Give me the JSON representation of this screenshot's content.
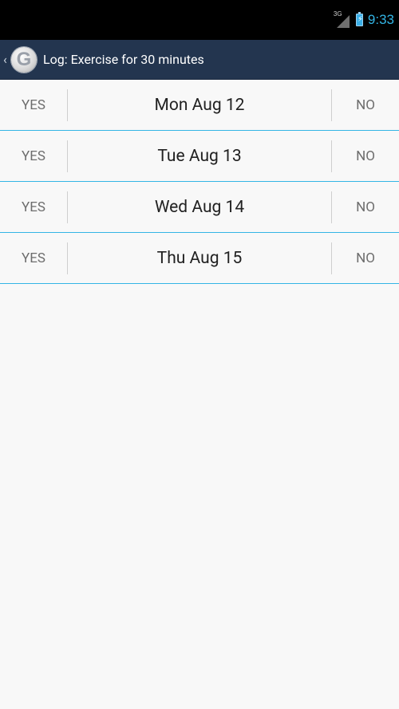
{
  "status_bar": {
    "network": "3G",
    "time": "9:33"
  },
  "action_bar": {
    "title": "Log: Exercise for 30 minutes",
    "logo_letter": "G"
  },
  "rows": [
    {
      "yes": "YES",
      "date": "Mon Aug 12",
      "no": "NO"
    },
    {
      "yes": "YES",
      "date": "Tue Aug 13",
      "no": "NO"
    },
    {
      "yes": "YES",
      "date": "Wed Aug 14",
      "no": "NO"
    },
    {
      "yes": "YES",
      "date": "Thu Aug 15",
      "no": "NO"
    }
  ],
  "colors": {
    "status_bar_bg": "#000000",
    "action_bar_bg": "#23354f",
    "accent": "#33b5e5",
    "background": "#f8f8f8"
  },
  "icons": {
    "network": "signal-3g-icon",
    "battery": "battery-charging-icon",
    "up": "up-caret-icon",
    "logo": "app-logo-icon"
  }
}
